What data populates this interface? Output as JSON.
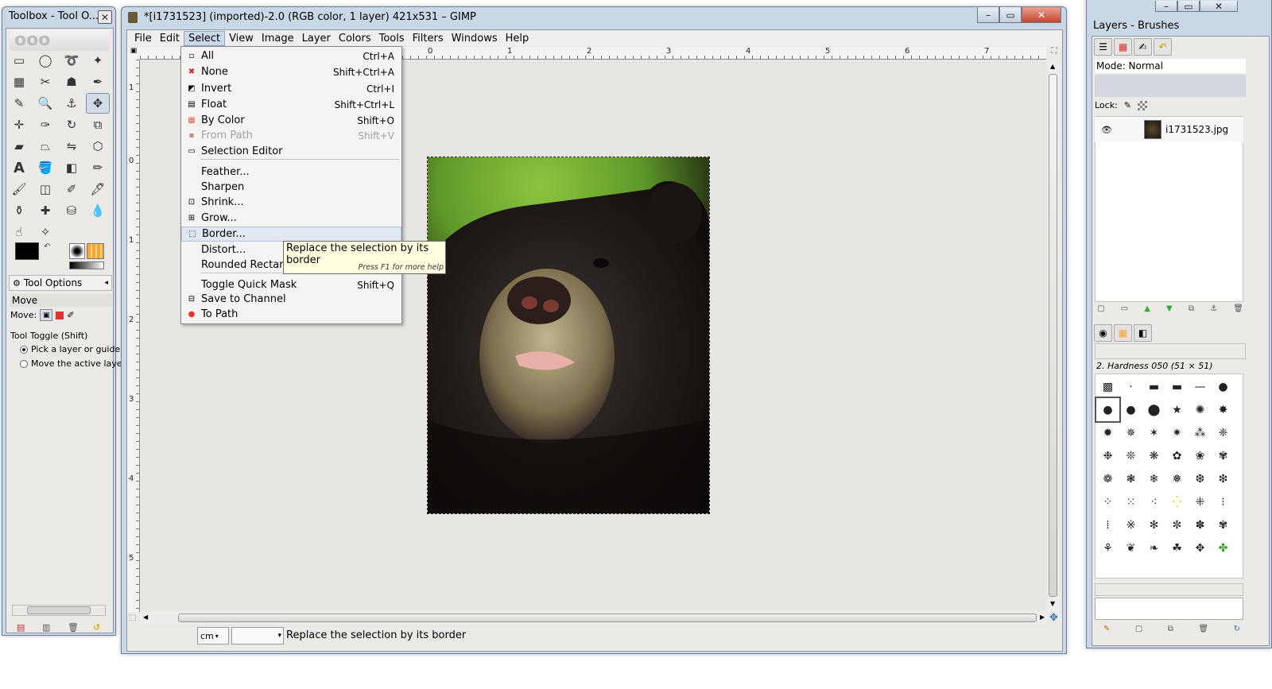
{
  "toolbox": {
    "title": "Toolbox - Tool O...",
    "close": "✕",
    "tools": [
      {
        "name": "rect-select-icon",
        "glyph": "▭"
      },
      {
        "name": "ellipse-select-icon",
        "glyph": "◯"
      },
      {
        "name": "free-select-icon",
        "glyph": "➰"
      },
      {
        "name": "fuzzy-select-icon",
        "glyph": "✦"
      },
      {
        "name": "select-by-color-icon",
        "glyph": "▦"
      },
      {
        "name": "scissors-select-icon",
        "glyph": "✂"
      },
      {
        "name": "foreground-select-icon",
        "glyph": "☗"
      },
      {
        "name": "paths-icon",
        "glyph": "✒"
      },
      {
        "name": "color-picker-icon",
        "glyph": "✎"
      },
      {
        "name": "zoom-icon",
        "glyph": "🔍"
      },
      {
        "name": "measure-icon",
        "glyph": "⚓"
      },
      {
        "name": "move-icon",
        "glyph": "✥"
      },
      {
        "name": "align-icon",
        "glyph": "✛"
      },
      {
        "name": "crop-icon",
        "glyph": "✑"
      },
      {
        "name": "rotate-icon",
        "glyph": "↻"
      },
      {
        "name": "scale-icon",
        "glyph": "⧉"
      },
      {
        "name": "shear-icon",
        "glyph": "▰"
      },
      {
        "name": "perspective-icon",
        "glyph": "⏢"
      },
      {
        "name": "flip-icon",
        "glyph": "⇋"
      },
      {
        "name": "cage-icon",
        "glyph": "⬡"
      },
      {
        "name": "text-icon",
        "glyph": "A"
      },
      {
        "name": "bucket-fill-icon",
        "glyph": "🪣"
      },
      {
        "name": "blend-icon",
        "glyph": "◧"
      },
      {
        "name": "pencil-icon",
        "glyph": "✏"
      },
      {
        "name": "paintbrush-icon",
        "glyph": "🖌"
      },
      {
        "name": "eraser-icon",
        "glyph": "◫"
      },
      {
        "name": "airbrush-icon",
        "glyph": "✐"
      },
      {
        "name": "ink-icon",
        "glyph": "🖋"
      },
      {
        "name": "clone-icon",
        "glyph": "⚱"
      },
      {
        "name": "heal-icon",
        "glyph": "✚"
      },
      {
        "name": "perspective-clone-icon",
        "glyph": "⛁"
      },
      {
        "name": "blur-icon",
        "glyph": "💧"
      },
      {
        "name": "smudge-icon",
        "glyph": "☝"
      },
      {
        "name": "dodge-burn-icon",
        "glyph": "✧"
      }
    ],
    "tool_options_tab": "Tool Options",
    "tool_name": "Move",
    "move_label": "Move:",
    "tool_toggle": "Tool Toggle  (Shift)",
    "radio_1": "Pick a layer or guide",
    "radio_2": "Move the active laye"
  },
  "image_window": {
    "title": "*[i1731523] (imported)-2.0 (RGB color, 1 layer) 421x531 – GIMP",
    "menus": [
      "File",
      "Edit",
      "Select",
      "View",
      "Image",
      "Layer",
      "Colors",
      "Tools",
      "Filters",
      "Windows",
      "Help"
    ],
    "ruler_h": [
      "0",
      "1",
      "2",
      "3",
      "4",
      "5",
      "6",
      "7"
    ],
    "ruler_v": [
      "1",
      "0",
      "1",
      "2",
      "3",
      "4",
      "5"
    ],
    "status": {
      "unit": "cm",
      "zoom": "",
      "message": "Replace the selection by its border"
    }
  },
  "select_menu": {
    "items": [
      {
        "label": "All",
        "accel": "Ctrl+A",
        "icon": "▫"
      },
      {
        "label": "None",
        "accel": "Shift+Ctrl+A",
        "icon": "✖"
      },
      {
        "label": "Invert",
        "accel": "Ctrl+I",
        "icon": "◩"
      },
      {
        "label": "Float",
        "accel": "Shift+Ctrl+L",
        "icon": "▤"
      },
      {
        "label": "By Color",
        "accel": "Shift+O",
        "icon": "▦"
      },
      {
        "label": "From Path",
        "accel": "Shift+V",
        "icon": "▪"
      },
      {
        "label": "Selection Editor",
        "accel": "",
        "icon": "▭"
      },
      {
        "label": "Feather...",
        "accel": "",
        "icon": ""
      },
      {
        "label": "Sharpen",
        "accel": "",
        "icon": ""
      },
      {
        "label": "Shrink...",
        "accel": "",
        "icon": "⊡"
      },
      {
        "label": "Grow...",
        "accel": "",
        "icon": "⊞"
      },
      {
        "label": "Border...",
        "accel": "",
        "icon": "⬚"
      },
      {
        "label": "Distort...",
        "accel": "",
        "icon": ""
      },
      {
        "label": "Rounded Rectang",
        "accel": "",
        "icon": ""
      },
      {
        "label": "Toggle Quick Mask",
        "accel": "Shift+Q",
        "icon": ""
      },
      {
        "label": "Save to Channel",
        "accel": "",
        "icon": "⊟"
      },
      {
        "label": "To Path",
        "accel": "",
        "icon": "●"
      }
    ]
  },
  "tooltip": {
    "text": "Replace the selection by its border",
    "hint": "Press F1 for more help"
  },
  "layers_dock": {
    "title": "Layers - Brushes",
    "mode_label": "Mode: Normal",
    "lock_label": "Lock:",
    "layer_name": "i1731523.jpg",
    "brush_name": "2. Hardness 050 (51 × 51)"
  },
  "colors": {
    "accent": "#cbd9ea",
    "foreground": "#000000",
    "background": "#ffffff"
  }
}
